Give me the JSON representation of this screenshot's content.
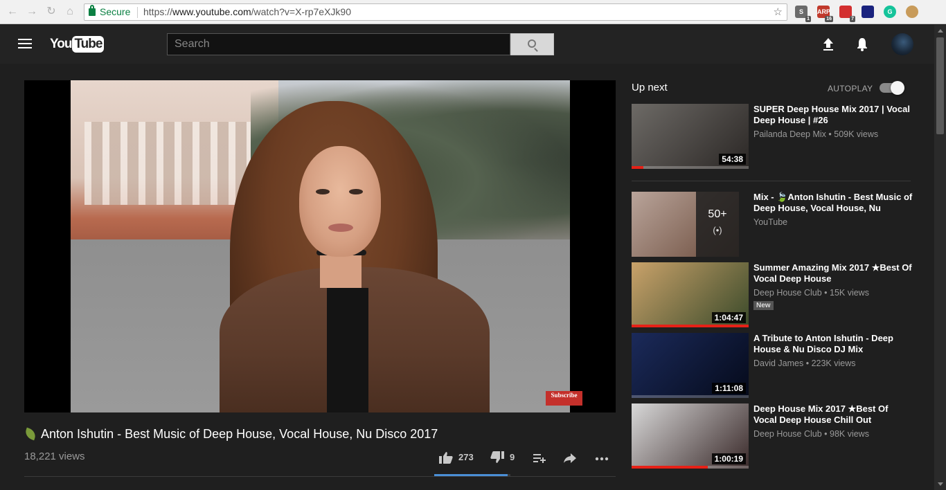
{
  "browser": {
    "secure_label": "Secure",
    "url_scheme": "https://",
    "url_host": "www.youtube.com",
    "url_path": "/watch?v=X-rp7eXJk90",
    "extensions": [
      {
        "name": "s-extension",
        "label": "S",
        "badge": "1",
        "color": "#6b6b6b"
      },
      {
        "name": "arp-extension",
        "label": "ARP",
        "badge": "16",
        "color": "#c0392b"
      },
      {
        "name": "red-extension",
        "label": "",
        "badge": "7",
        "color": "#d32f2f"
      },
      {
        "name": "blue-extension",
        "label": "",
        "badge": "",
        "color": "#1a237e"
      },
      {
        "name": "grammarly-extension",
        "label": "G",
        "badge": "",
        "color": "#15c39a"
      },
      {
        "name": "cookie-extension",
        "label": "",
        "badge": "",
        "color": "#c89b5a"
      }
    ]
  },
  "masthead": {
    "logo_you": "You",
    "logo_tube": "Tube",
    "search_placeholder": "Search"
  },
  "video": {
    "title": "Anton Ishutin - Best Music of Deep House, Vocal House, Nu Disco 2017",
    "views": "18,221 views",
    "likes": "273",
    "dislikes": "9",
    "like_ratio": 0.968,
    "subscribe_overlay": "Subscribe"
  },
  "sidebar": {
    "up_next_label": "Up next",
    "autoplay_label": "AUTOPLAY",
    "autoplay_on": true,
    "items": [
      {
        "title": "SUPER Deep House Mix 2017 | Vocal Deep House | #26",
        "meta": "Pailanda Deep Mix • 509K views",
        "duration": "54:38",
        "progress": 0.1,
        "colors": [
          "#6d6a66",
          "#2b2725"
        ]
      },
      {
        "title": "Mix - 🍃Anton Ishutin - Best Music of Deep House, Vocal House, Nu",
        "meta": "YouTube",
        "playlist_count": "50+",
        "colors": [
          "#b9a49a",
          "#6a4a3a"
        ]
      },
      {
        "title": "Summer Amazing Mix 2017 ★Best Of Vocal Deep House",
        "meta": "Deep House Club • 15K views",
        "badge": "New",
        "duration": "1:04:47",
        "progress": 1.0,
        "colors": [
          "#c9a26a",
          "#3a4a2a"
        ]
      },
      {
        "title": "A Tribute to Anton Ishutin - Deep House & Nu Disco DJ Mix",
        "meta": "David James • 223K views",
        "duration": "1:11:08",
        "progress": 0.0,
        "colors": [
          "#1b2a5a",
          "#050a1a"
        ]
      },
      {
        "title": "Deep House Mix 2017 ★Best Of Vocal Deep House Chill Out",
        "meta": "Deep House Club • 98K views",
        "duration": "1:00:19",
        "progress": 0.65,
        "colors": [
          "#d8d8d8",
          "#3a2a2a"
        ]
      }
    ]
  },
  "colors": {
    "accent_red": "#e62117",
    "sentiment_blue": "#4a8fd6",
    "background": "#1f1f1f"
  }
}
